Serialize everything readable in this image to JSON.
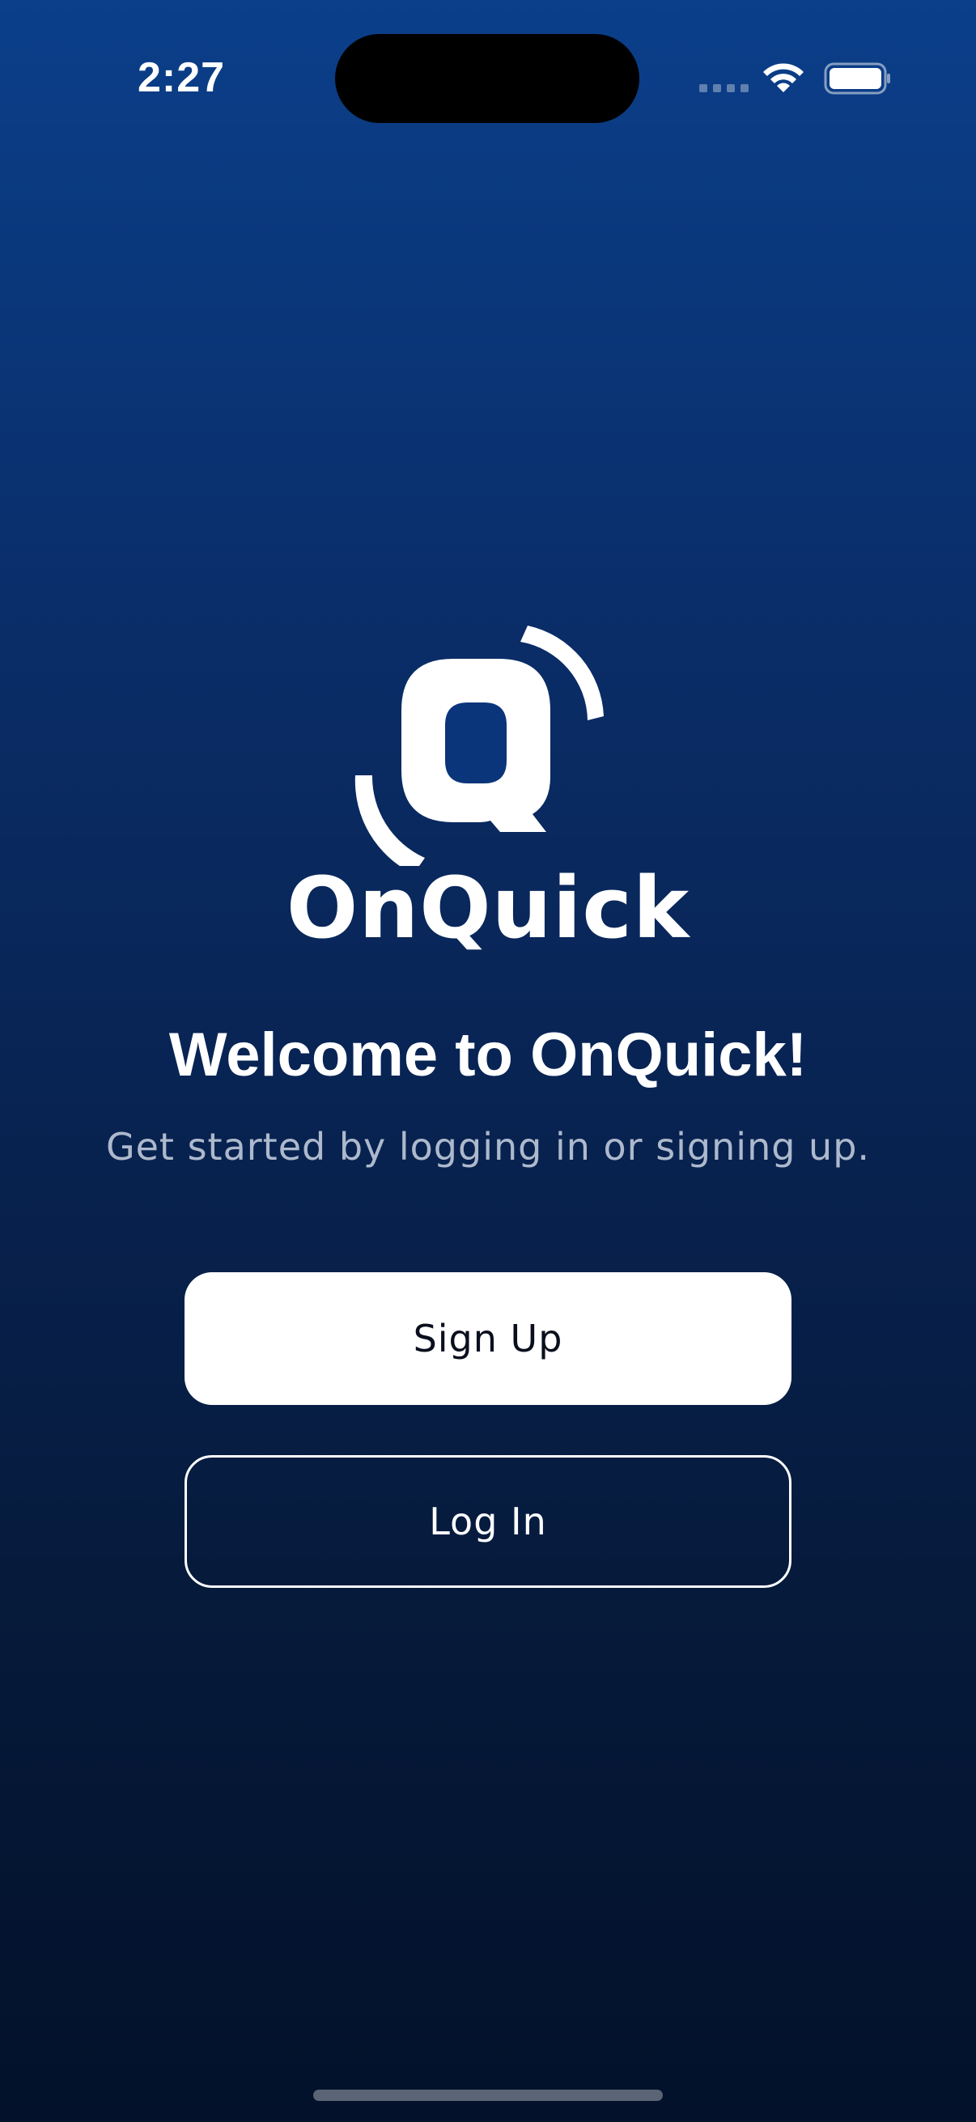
{
  "status_bar": {
    "time": "2:27",
    "icons": [
      "cellular-signal-icon",
      "wifi-icon",
      "battery-icon"
    ]
  },
  "brand": {
    "name": "OnQuick",
    "logo_icon": "onquick-q-logo-icon"
  },
  "welcome": {
    "title": "Welcome to OnQuick!",
    "subtitle": "Get started by logging in or signing up."
  },
  "actions": {
    "signup_label": "Sign Up",
    "login_label": "Log In"
  },
  "colors": {
    "background_top": "#0b3f8a",
    "background_bottom": "#03112a",
    "primary_button_bg": "#ffffff",
    "primary_button_text": "#0a0f1e",
    "text": "#ffffff"
  }
}
